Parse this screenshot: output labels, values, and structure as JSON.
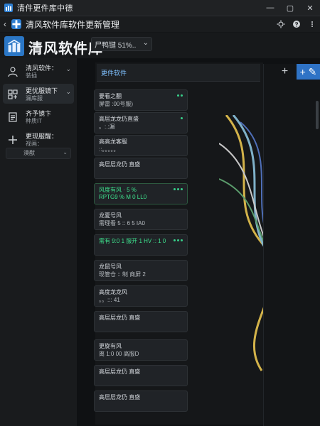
{
  "window": {
    "title": "清件更件库中德",
    "controls": [
      "minimize-icon",
      "maximize-icon",
      "close-icon"
    ]
  },
  "toolbar": {
    "title": "清风软件库软件更新管理",
    "actions": [
      "settings-icon",
      "help-icon",
      "more-icon"
    ]
  },
  "hero": {
    "app_name": "清风软件库",
    "filter": {
      "text": "尸鸭键 51%..",
      "chevron": "⌄"
    }
  },
  "sidebar": {
    "items": [
      {
        "label": "清风软件：",
        "sub": "装插",
        "icon": "user-icon",
        "active": false
      },
      {
        "label": "更优服镜下",
        "sub": "漏库服",
        "icon": "tools-icon",
        "active": true
      },
      {
        "label": "齐予镜卞",
        "sub": "种质IT",
        "icon": "doc-icon",
        "active": false
      },
      {
        "label": "更现服醒：",
        "sub": "视画：",
        "icon": "plus-icon",
        "active": false
      }
    ],
    "select": {
      "value": "漠猷",
      "chev": "⌄"
    }
  },
  "content": {
    "rack_title": "更件软件",
    "units": [
      {
        "line1": "要看之翻",
        "line2": "屏雷 :00号服)"
      },
      {
        "line1": "高层龙龙仍直盛",
        "line2": "。:.:漏"
      },
      {
        "line1": "高高龙客服",
        "line2": "::。。。。。"
      },
      {
        "line1": "高层层龙仍 直盛",
        "line2": ""
      },
      {
        "line1": "风度有风 · 5 %",
        "line2": "RPTG9 % M 0 LL0"
      },
      {
        "line1": "龙夏号风",
        "line2": "需理看 5 :: 6 5 IA0"
      },
      {
        "line1": "需有 9:0 1 服开 1 HV :: 1 0",
        "line2": ""
      },
      {
        "line1": "龙鼠号风",
        "line2": "现管仓 :: 制 商屏 2"
      },
      {
        "line1": "高度龙龙风",
        "line2": "。。::: 41"
      },
      {
        "line1": "高层层龙仍 直盛",
        "line2": ""
      },
      {
        "line1": "更旋有风",
        "line2": "离 1:0 00 高服D"
      },
      {
        "line1": "高层层龙仍 直盛",
        "line2": ""
      },
      {
        "line1": "高层层龙仍 直盛",
        "line2": ""
      }
    ],
    "buttons": {
      "add": "+",
      "edit": "+ ✎"
    }
  }
}
